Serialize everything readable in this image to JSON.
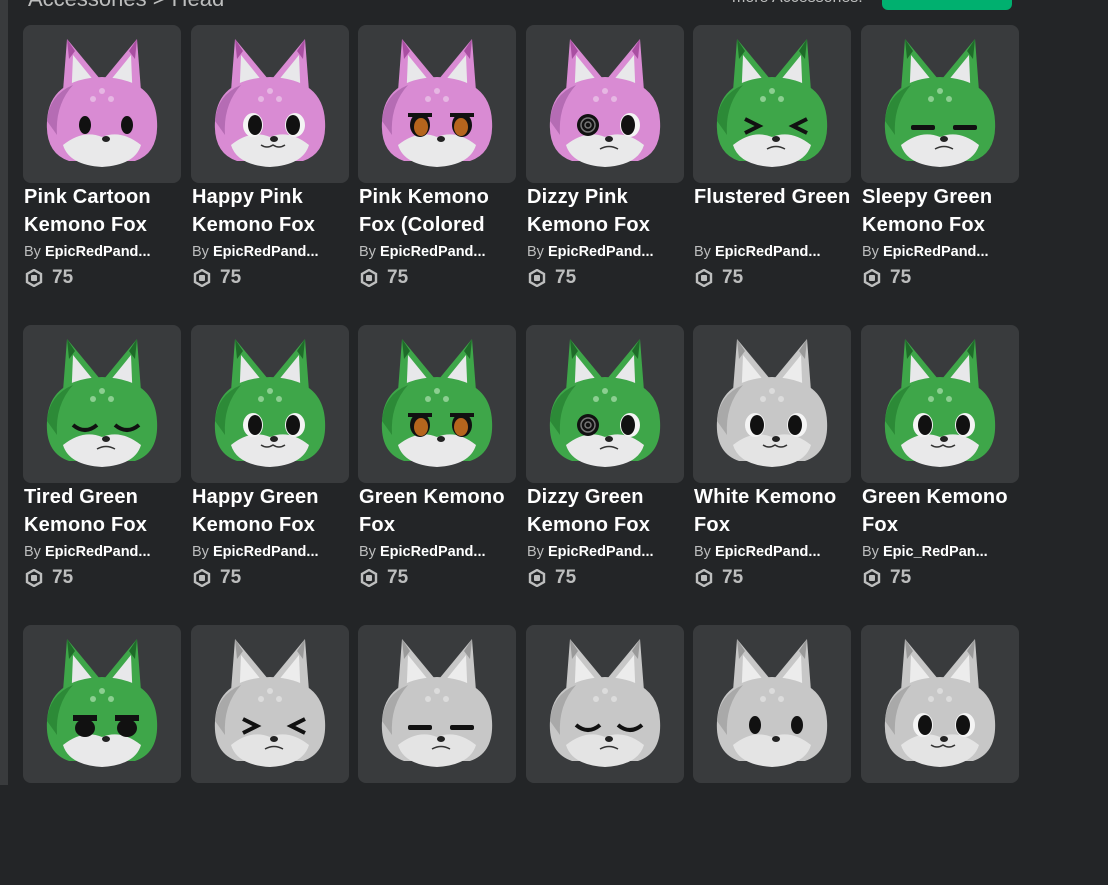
{
  "header": {
    "breadcrumb": "Accessories > Head",
    "more_label": "more Accessories."
  },
  "colors": {
    "background": "#232527",
    "card": "#393b3d",
    "accent_green": "#00b06f",
    "pink": "#d98bd3",
    "green": "#3ea649",
    "white_fox": "#c7c7c7"
  },
  "items": [
    {
      "name": "Pink Cartoon Kemono Fox",
      "by": "By",
      "creator": "EpicRedPand...",
      "price": "75",
      "fox": "pink",
      "eyes": "cartoon"
    },
    {
      "name": "Happy Pink Kemono Fox",
      "by": "By",
      "creator": "EpicRedPand...",
      "price": "75",
      "fox": "pink",
      "eyes": "happy"
    },
    {
      "name": "Pink Kemono Fox (Colored",
      "by": "By",
      "creator": "EpicRedPand...",
      "price": "75",
      "fox": "pink",
      "eyes": "colored"
    },
    {
      "name": "Dizzy Pink Kemono Fox",
      "by": "By",
      "creator": "EpicRedPand...",
      "price": "75",
      "fox": "pink",
      "eyes": "dizzy"
    },
    {
      "name": "Flustered Green",
      "by": "By",
      "creator": "EpicRedPand...",
      "price": "75",
      "fox": "green",
      "eyes": "flustered"
    },
    {
      "name": "Sleepy Green Kemono Fox",
      "by": "By",
      "creator": "EpicRedPand...",
      "price": "75",
      "fox": "green",
      "eyes": "sleepy"
    },
    {
      "name": "Tired Green Kemono Fox",
      "by": "By",
      "creator": "EpicRedPand...",
      "price": "75",
      "fox": "green",
      "eyes": "tired"
    },
    {
      "name": "Happy Green Kemono Fox",
      "by": "By",
      "creator": "EpicRedPand...",
      "price": "75",
      "fox": "green",
      "eyes": "happy"
    },
    {
      "name": "Green Kemono Fox",
      "by": "By",
      "creator": "EpicRedPand...",
      "price": "75",
      "fox": "green",
      "eyes": "colored"
    },
    {
      "name": "Dizzy Green Kemono Fox",
      "by": "By",
      "creator": "EpicRedPand...",
      "price": "75",
      "fox": "green",
      "eyes": "dizzy"
    },
    {
      "name": "White Kemono Fox",
      "by": "By",
      "creator": "EpicRedPand...",
      "price": "75",
      "fox": "white",
      "eyes": "normal"
    },
    {
      "name": "Green Kemono Fox",
      "by": "By",
      "creator": "Epic_RedPan...",
      "price": "75",
      "fox": "green",
      "eyes": "normal"
    },
    {
      "name": "",
      "by": "",
      "creator": "",
      "price": "",
      "fox": "green",
      "eyes": "annoyed"
    },
    {
      "name": "",
      "by": "",
      "creator": "",
      "price": "",
      "fox": "white",
      "eyes": "flustered"
    },
    {
      "name": "",
      "by": "",
      "creator": "",
      "price": "",
      "fox": "white",
      "eyes": "sleepy"
    },
    {
      "name": "",
      "by": "",
      "creator": "",
      "price": "",
      "fox": "white",
      "eyes": "tired"
    },
    {
      "name": "",
      "by": "",
      "creator": "",
      "price": "",
      "fox": "white",
      "eyes": "cartoon"
    },
    {
      "name": "",
      "by": "",
      "creator": "",
      "price": "",
      "fox": "white",
      "eyes": "happy"
    }
  ]
}
